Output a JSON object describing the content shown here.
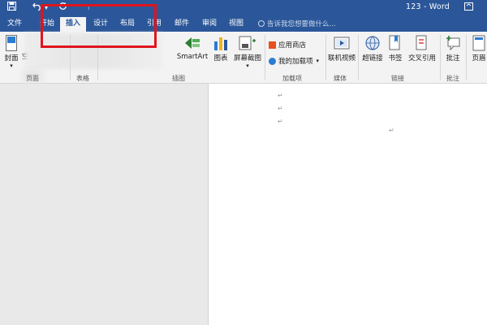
{
  "title_bar": {
    "save_icon": "save-icon",
    "undo_icon": "undo-icon",
    "redo_icon": "redo-icon",
    "customize_icon": "customize-qat-icon",
    "document_title": "123 - Word"
  },
  "tabs": [
    {
      "label": "文件"
    },
    {
      "label": "开始"
    },
    {
      "label": "插入",
      "active": true
    },
    {
      "label": "设计"
    },
    {
      "label": "布局"
    },
    {
      "label": "引用"
    },
    {
      "label": "邮件"
    },
    {
      "label": "审阅"
    },
    {
      "label": "视图"
    }
  ],
  "tell_me": {
    "placeholder": "告诉我您想要做什么...",
    "icon": "lightbulb-icon"
  },
  "ribbon": {
    "pages": {
      "cover_label": "封面",
      "blank_label": "空",
      "group": "页面"
    },
    "tables": {
      "group": "表格"
    },
    "illustrations": {
      "smartart": "SmartArt",
      "chart": "图表",
      "screenshot": "屏幕截图",
      "group": "插图"
    },
    "addins": {
      "store": "应用商店",
      "my_addins": "我的加载项",
      "group": "加载项"
    },
    "media": {
      "online_video": "联机视频",
      "group": "媒体"
    },
    "links": {
      "hyperlink": "超链接",
      "bookmark": "书签",
      "cross_reference": "交叉引用",
      "group": "链接"
    },
    "comments": {
      "comment": "批注",
      "group": "批注"
    },
    "header_footer": {
      "header": "页眉"
    }
  },
  "colors": {
    "accent": "#2b579a",
    "highlight": "#e0141c"
  }
}
